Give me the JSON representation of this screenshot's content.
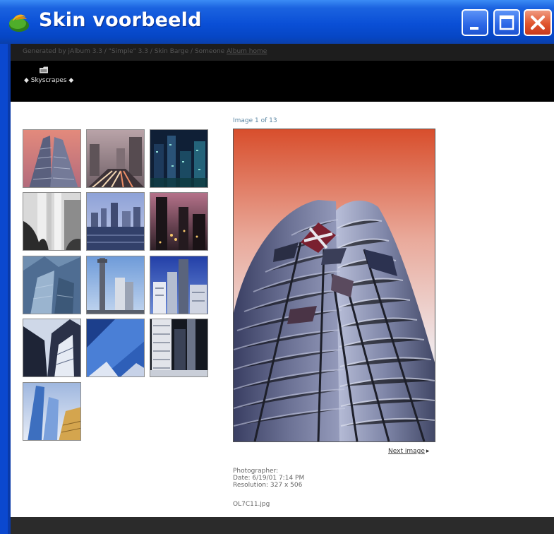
{
  "window": {
    "title": "Skin voorbeeld",
    "title_bar_color": "#0a4fd6",
    "close_button_color": "#e0552e"
  },
  "credits": {
    "prefix": "Generated by jAlbum 3.3 / \"Simple\" 3.3 / Skin Barge / Someone",
    "link": "Album home"
  },
  "breadcrumb": {
    "label": "◆ Skyscrapes ◆",
    "icon": "folder-icon"
  },
  "gallery": {
    "thumbnail_count": 13,
    "thumbnails": [
      "thumb-1",
      "thumb-2",
      "thumb-3",
      "thumb-4",
      "thumb-5",
      "thumb-6",
      "thumb-7",
      "thumb-8",
      "thumb-9",
      "thumb-10",
      "thumb-11",
      "thumb-12",
      "thumb-13"
    ]
  },
  "viewer": {
    "counter": "Image 1 of 13",
    "next_label": "Next image",
    "next_arrow": "▸",
    "photographer": "Photographer:",
    "date": "Date: 6/19/01 7:14 PM",
    "resolution": "Resolution: 327 x 506",
    "filename": "OL7C11.jpg"
  }
}
